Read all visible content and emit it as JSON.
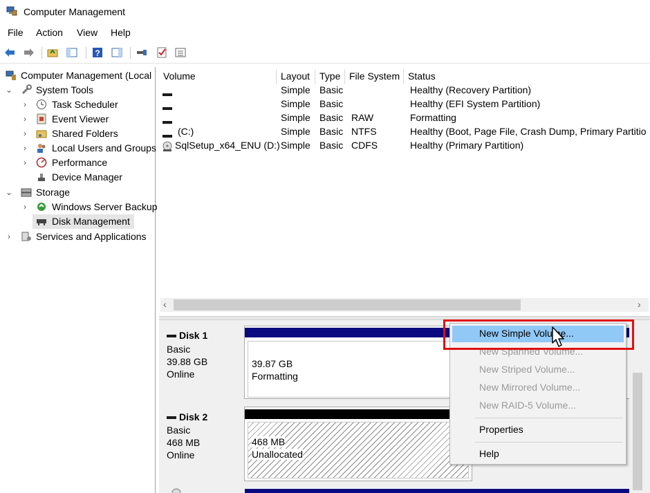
{
  "window": {
    "title": "Computer Management"
  },
  "menu": [
    "File",
    "Action",
    "View",
    "Help"
  ],
  "toolbar_icons": [
    "back-arrow-icon",
    "forward-arrow-icon",
    "up-folder-icon",
    "show-hide-tree-icon",
    "help-icon",
    "show-hide-action-pane-icon",
    "connect-icon",
    "properties-check-icon",
    "list-icon"
  ],
  "tree": {
    "root": "Computer Management (Local",
    "system_tools": "System Tools",
    "task_scheduler": "Task Scheduler",
    "event_viewer": "Event Viewer",
    "shared_folders": "Shared Folders",
    "local_users": "Local Users and Groups",
    "performance": "Performance",
    "device_manager": "Device Manager",
    "storage": "Storage",
    "wsb": "Windows Server Backup",
    "disk_mgmt": "Disk Management",
    "services": "Services and Applications"
  },
  "volume_columns": [
    "Volume",
    "Layout",
    "Type",
    "File System",
    "Status"
  ],
  "volumes": [
    {
      "volume": "",
      "layout": "Simple",
      "type": "Basic",
      "fs": "",
      "status": "Healthy (Recovery Partition)"
    },
    {
      "volume": "",
      "layout": "Simple",
      "type": "Basic",
      "fs": "",
      "status": "Healthy (EFI System Partition)"
    },
    {
      "volume": "",
      "layout": "Simple",
      "type": "Basic",
      "fs": "RAW",
      "status": "Formatting"
    },
    {
      "volume": "(C:)",
      "layout": "Simple",
      "type": "Basic",
      "fs": "NTFS",
      "status": "Healthy (Boot, Page File, Crash Dump, Primary Partitio"
    },
    {
      "volume": "SqlSetup_x64_ENU (D:)",
      "layout": "Simple",
      "type": "Basic",
      "fs": "CDFS",
      "status": "Healthy (Primary Partition)"
    }
  ],
  "disks": [
    {
      "name": "Disk 1",
      "type": "Basic",
      "size": "39.88 GB",
      "state": "Online",
      "part_size": "39.87 GB",
      "part_status": "Formatting"
    },
    {
      "name": "Disk 2",
      "type": "Basic",
      "size": "468 MB",
      "state": "Online",
      "part_size": "468 MB",
      "part_status": "Unallocated"
    }
  ],
  "context_menu": {
    "new_simple": "New Simple Volume...",
    "new_spanned": "New Spanned Volume...",
    "new_striped": "New Striped Volume...",
    "new_mirrored": "New Mirrored Volume...",
    "new_raid5": "New RAID-5 Volume...",
    "properties": "Properties",
    "help": "Help"
  },
  "colors": {
    "highlight_border": "#e01010",
    "menu_hover": "#90c8f6",
    "partition_bar_blue": "#0a0a80"
  }
}
